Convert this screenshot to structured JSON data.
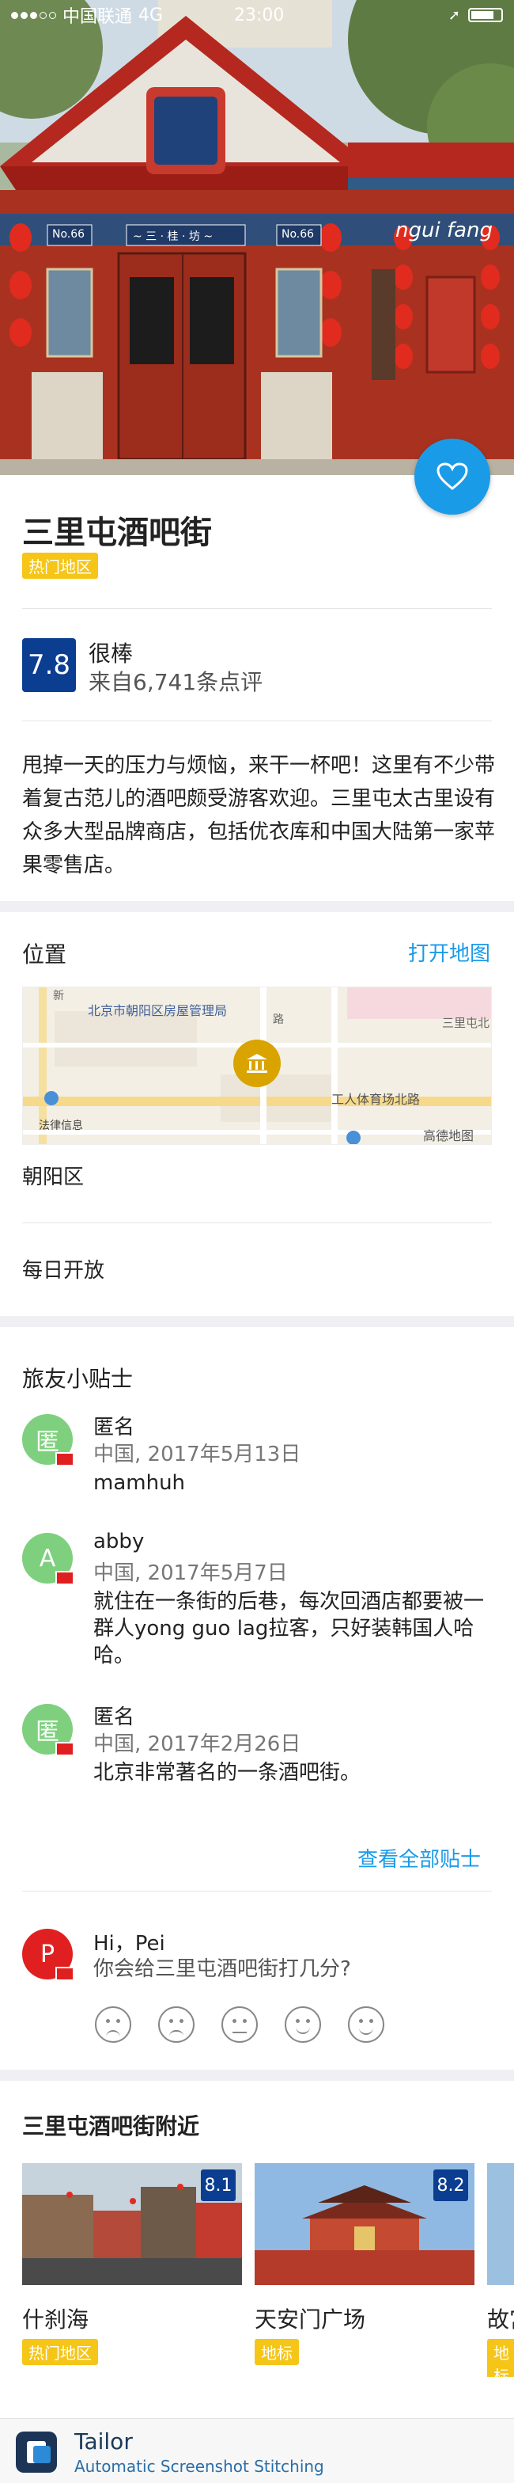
{
  "status_bar": {
    "carrier": "中国联通",
    "network": "4G",
    "time": "23:00"
  },
  "place": {
    "title": "三里屯酒吧街",
    "tag": "热门地区",
    "score": "7.8",
    "score_label": "很棒",
    "review_count_text": "来自6,741条点评",
    "description": "甩掉一天的压力与烦恼，来干一杯吧！这里有不少带着复古范儿的酒吧颇受游客欢迎。三里屯太古里设有众多大型品牌商店，包括优衣库和中国大陆第一家苹果零售店。"
  },
  "hero_sign": {
    "left_no": "No.66",
    "right_no": "No.66",
    "center_text": "~ 三 · 桂 · 坊 ~",
    "side_text": "ngui fang"
  },
  "location": {
    "header": "位置",
    "open_map": "打开地图",
    "map_labels": {
      "office": "北京市朝阳区房屋管理局",
      "road": "工人体育场北路",
      "legal": "法律信息",
      "brand": "高德地图",
      "top_right": "三里屯北",
      "edge_left": "新",
      "edge_mid": "路"
    },
    "district": "朝阳区",
    "hours": "每日开放"
  },
  "tips": {
    "header": "旅友小贴士",
    "items": [
      {
        "avatar": "匿",
        "avatar_color": "#7ed07e",
        "name": "匿名",
        "meta": "中国, 2017年5月13日",
        "body": "mamhuh"
      },
      {
        "avatar": "A",
        "avatar_color": "#7ed07e",
        "name": "abby",
        "meta": "中国, 2017年5月7日",
        "body": "就住在一条街的后巷，每次回酒店都要被一群人yong guo lag拉客，只好装韩国人哈哈。"
      },
      {
        "avatar": "匿",
        "avatar_color": "#7ed07e",
        "name": "匿名",
        "meta": "中国, 2017年2月26日",
        "body": "北京非常著名的一条酒吧街。"
      }
    ],
    "view_all": "查看全部贴士"
  },
  "rate": {
    "avatar": "P",
    "avatar_color": "#e02020",
    "greeting": "Hi，Pei",
    "question": "你会给三里屯酒吧街打几分?",
    "faces": [
      "very-sad-face-icon",
      "sad-face-icon",
      "neutral-face-icon",
      "happy-face-icon",
      "very-happy-face-icon"
    ]
  },
  "nearby": {
    "header": "三里屯酒吧街附近",
    "cards": [
      {
        "name": "什刹海",
        "tag": "热门地区",
        "score": "8.1"
      },
      {
        "name": "天安门广场",
        "tag": "地标",
        "score": "8.2"
      },
      {
        "name": "故宫",
        "tag": "地标",
        "score": ""
      }
    ]
  },
  "footer": {
    "app_name": "Tailor",
    "tagline": "Automatic Screenshot Stitching"
  },
  "colors": {
    "accent": "#1a9be8",
    "score_bg": "#0b3d91",
    "tag_bg": "#f5c518",
    "hero_red": "#c0392b"
  }
}
